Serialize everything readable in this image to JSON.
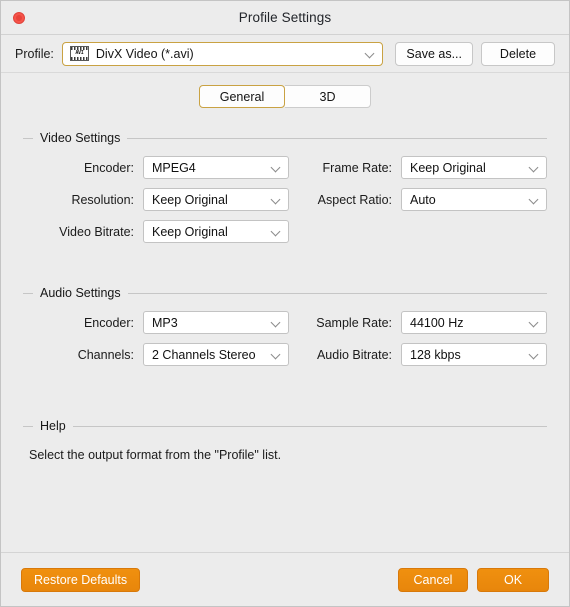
{
  "window": {
    "title": "Profile Settings",
    "close_icon": "close-icon"
  },
  "profile": {
    "label": "Profile:",
    "icon": "avi-file-icon",
    "icon_text": "AVI",
    "value": "DivX Video (*.avi)",
    "save_as_label": "Save as...",
    "delete_label": "Delete"
  },
  "tabs": [
    {
      "label": "General",
      "active": true
    },
    {
      "label": "3D",
      "active": false
    }
  ],
  "video_settings": {
    "title": "Video Settings",
    "fields": [
      {
        "label": "Encoder:",
        "value": "MPEG4"
      },
      {
        "label": "Frame Rate:",
        "value": "Keep Original"
      },
      {
        "label": "Resolution:",
        "value": "Keep Original"
      },
      {
        "label": "Aspect Ratio:",
        "value": "Auto"
      },
      {
        "label": "Video Bitrate:",
        "value": "Keep Original"
      }
    ]
  },
  "audio_settings": {
    "title": "Audio Settings",
    "fields": [
      {
        "label": "Encoder:",
        "value": "MP3"
      },
      {
        "label": "Sample Rate:",
        "value": "44100 Hz"
      },
      {
        "label": "Channels:",
        "value": "2 Channels Stereo"
      },
      {
        "label": "Audio Bitrate:",
        "value": "128 kbps"
      }
    ]
  },
  "help": {
    "title": "Help",
    "text": "Select the output format from the \"Profile\" list."
  },
  "footer": {
    "restore_label": "Restore Defaults",
    "cancel_label": "Cancel",
    "ok_label": "OK"
  },
  "colors": {
    "accent_orange": "#e8860b",
    "focus_gold": "#c9a243",
    "close_red": "#f6544a",
    "window_bg": "#ececec"
  }
}
